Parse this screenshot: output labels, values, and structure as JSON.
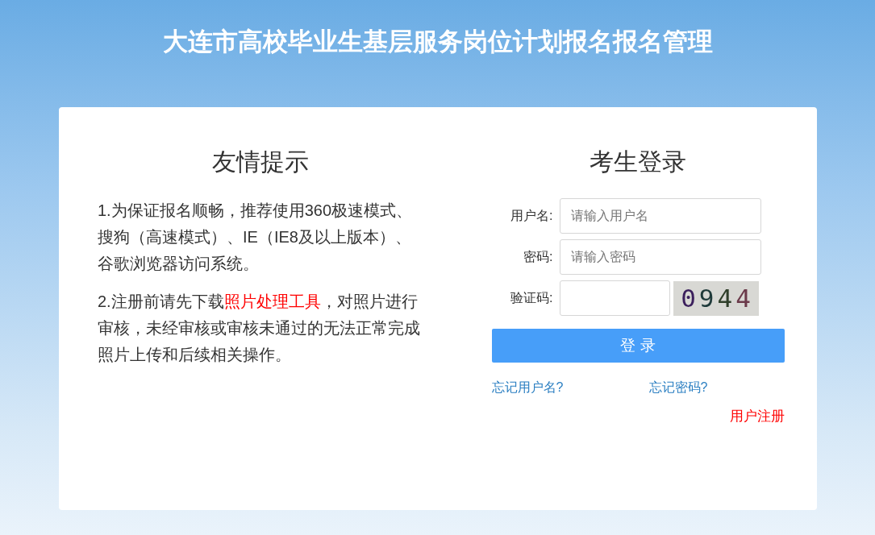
{
  "header": {
    "title": "大连市高校毕业生基层服务岗位计划报名报名管理"
  },
  "notice": {
    "title": "友情提示",
    "paragraphs": [
      {
        "text": "1.为保证报名顺畅，推荐使用360极速模式、搜狗（高速模式）、IE（IE8及以上版本）、谷歌浏览器访问系统。"
      },
      {
        "before": "2.注册前请先下载",
        "link": "照片处理工具",
        "after": "，对照片进行审核，未经审核或审核未通过的无法正常完成照片上传和后续相关操作。"
      }
    ]
  },
  "login": {
    "title": "考生登录",
    "fields": [
      {
        "label": "用户名:",
        "placeholder": "请输入用户名",
        "kind": "text"
      },
      {
        "label": "密码:",
        "placeholder": "请输入密码",
        "kind": "password"
      },
      {
        "label": "验证码:",
        "kind": "captcha",
        "captcha": "0944"
      }
    ],
    "button": "登 录",
    "links": [
      "忘记用户名?",
      "忘记密码?"
    ],
    "register": "用户注册"
  }
}
